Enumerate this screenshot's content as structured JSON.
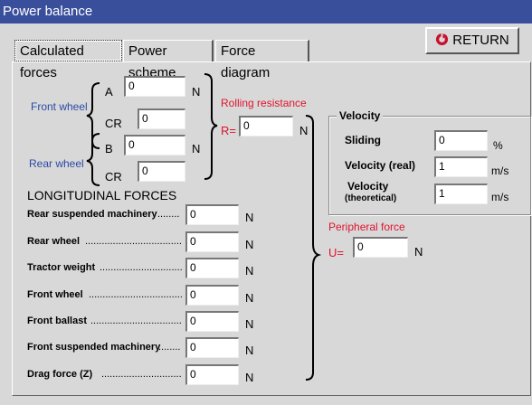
{
  "window": {
    "title": "Power balance"
  },
  "tabs": [
    {
      "label": "Calculated forces",
      "active": true
    },
    {
      "label": "Power scheme",
      "active": false
    },
    {
      "label": "Force diagram",
      "active": false
    }
  ],
  "return_button": {
    "label": "RETURN"
  },
  "wheels": {
    "front_label": "Front wheel",
    "rear_label": "Rear wheel",
    "a_label": "A",
    "a_value": "0",
    "a_unit": "N",
    "cr_front_label": "CR",
    "cr_front_value": "0",
    "b_label": "B",
    "b_value": "0",
    "b_unit": "N",
    "cr_rear_label": "CR",
    "cr_rear_value": "0"
  },
  "rolling": {
    "title": "Rolling resistance",
    "prefix": "R=",
    "value": "0",
    "unit": "N"
  },
  "longitudinal": {
    "title": "LONGITUDINAL FORCES",
    "rows": [
      {
        "label": "Rear suspended machinery",
        "dots": "........",
        "value": "0",
        "unit": "N"
      },
      {
        "label": "Rear wheel",
        "dots": "....................................",
        "value": "0",
        "unit": "N"
      },
      {
        "label": "Tractor weight",
        "dots": "...............................",
        "value": "0",
        "unit": "N"
      },
      {
        "label": "Front wheel",
        "dots": "...................................",
        "value": "0",
        "unit": "N"
      },
      {
        "label": "Front ballast",
        "dots": "...................................",
        "value": "0",
        "unit": "N"
      },
      {
        "label": "Front suspended machinery",
        "dots": "........",
        "value": "0",
        "unit": "N"
      },
      {
        "label": "Drag force (Z)",
        "dots": "...............................",
        "value": "0",
        "unit": "N"
      }
    ]
  },
  "velocity": {
    "title": "Velocity",
    "sliding_label": "Sliding",
    "sliding_value": "0",
    "sliding_unit": "%",
    "real_label": "Velocity (real)",
    "real_value": "1",
    "real_unit": "m/s",
    "theo_label_1": "Velocity",
    "theo_label_2": "(theoretical)",
    "theo_value": "1",
    "theo_unit": "m/s"
  },
  "peripheral": {
    "title": "Peripheral force",
    "prefix": "U=",
    "value": "0",
    "unit": "N"
  }
}
